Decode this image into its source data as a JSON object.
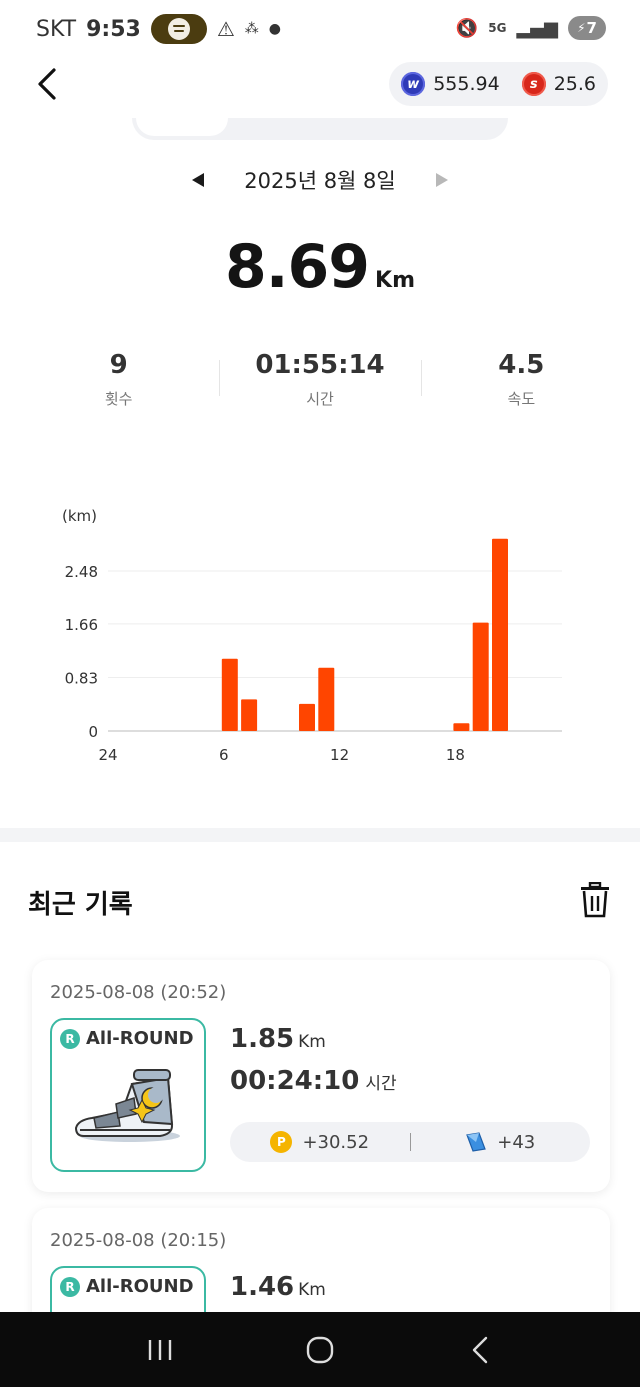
{
  "status_bar": {
    "carrier": "SKT",
    "time": "9:53",
    "battery_level": "7"
  },
  "header": {
    "balances": [
      {
        "icon": "w-coin-icon",
        "value": "555.94",
        "color": "#2f3bb8"
      },
      {
        "icon": "s-coin-icon",
        "value": "25.6",
        "color": "#d8271b"
      }
    ]
  },
  "date_nav": {
    "date_label": "2025년 8월 8일"
  },
  "summary": {
    "distance": "8.69",
    "distance_unit": "Km",
    "stats": [
      {
        "value": "9",
        "label": "횟수"
      },
      {
        "value": "01:55:14",
        "label": "시간"
      },
      {
        "value": "4.5",
        "label": "속도"
      }
    ]
  },
  "chart_data": {
    "type": "bar",
    "ylabel": "(km)",
    "y_ticks": [
      "0",
      "0.83",
      "1.66",
      "2.48"
    ],
    "ylim": [
      0,
      2.48
    ],
    "x_tick_labels": [
      "24",
      "6",
      "12",
      "18"
    ],
    "x_tick_hours": [
      0,
      6,
      12,
      18
    ],
    "bar_color": "#ff4500",
    "grid": true,
    "bars": [
      {
        "hour": 6,
        "value": 1.12
      },
      {
        "hour": 7,
        "value": 0.49
      },
      {
        "hour": 10,
        "value": 0.42
      },
      {
        "hour": 11,
        "value": 0.98
      },
      {
        "hour": 18,
        "value": 0.12
      },
      {
        "hour": 19,
        "value": 1.68
      },
      {
        "hour": 20,
        "value": 2.98
      }
    ]
  },
  "recent": {
    "title": "최근 기록",
    "records": [
      {
        "date": "2025-08-08 (20:52)",
        "shoe_grade": "R",
        "shoe_name": "All-ROUND",
        "distance": "1.85",
        "distance_unit": "Km",
        "duration": "00:24:10",
        "duration_unit": "시간",
        "reward_points": "+30.52",
        "reward_gems": "+43"
      },
      {
        "date": "2025-08-08 (20:15)",
        "shoe_grade": "R",
        "shoe_name": "All-ROUND",
        "distance": "1.46",
        "distance_unit": "Km"
      }
    ]
  }
}
